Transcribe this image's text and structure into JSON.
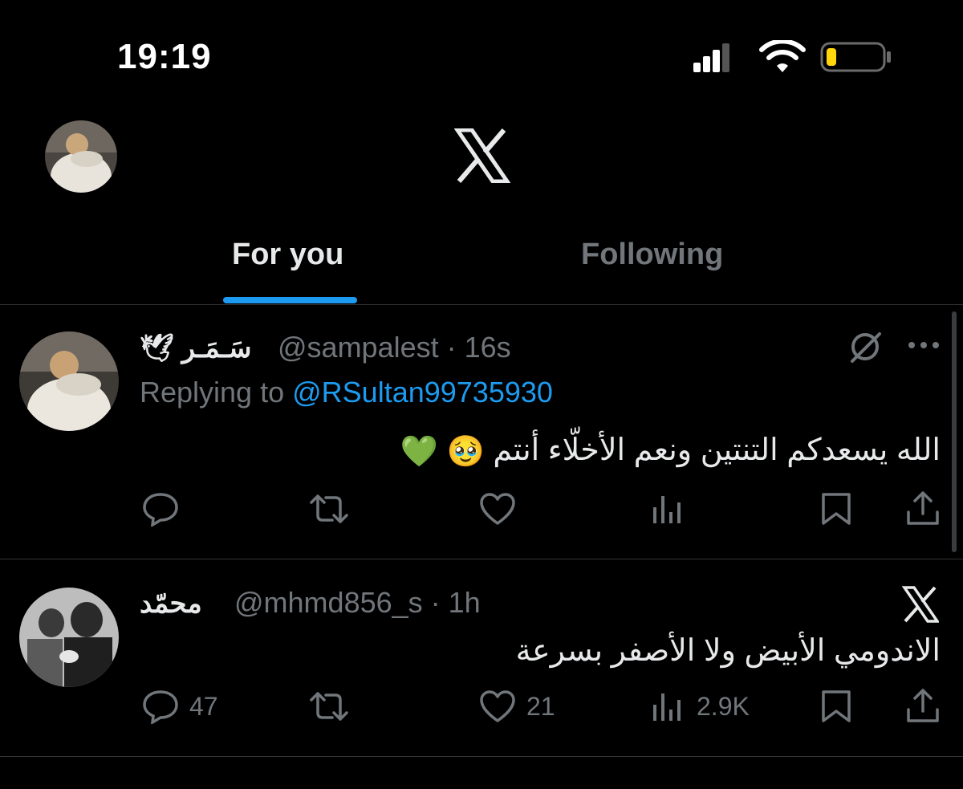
{
  "status_bar": {
    "time": "19:19"
  },
  "tabs": [
    {
      "label": "For you",
      "active": true
    },
    {
      "label": "Following",
      "active": false
    }
  ],
  "tweets": [
    {
      "display_name": "سَـمَـر 🕊",
      "handle_time": "@sampalest · 16s",
      "replying_prefix": "Replying to",
      "replying_to": "@RSultan99735930",
      "text": "الله يسعدكم التنتين ونعم الأخلّاء أنتم",
      "emojis": "🥹 💚",
      "stats": {
        "replies": "",
        "retweets": "",
        "likes": "",
        "views": ""
      }
    },
    {
      "display_name": "محمّد",
      "handle_time": "@mhmd856_s · 1h",
      "text": "الاندومي الأبيض ولا الأصفر بسرعة",
      "stats": {
        "replies": "47",
        "retweets": "",
        "likes": "21",
        "views": "2.9K"
      }
    }
  ],
  "colors": {
    "accent": "#1d9bf0",
    "muted": "#71767b",
    "text": "#e7e9ea",
    "battery_low": "#ffd60a"
  }
}
